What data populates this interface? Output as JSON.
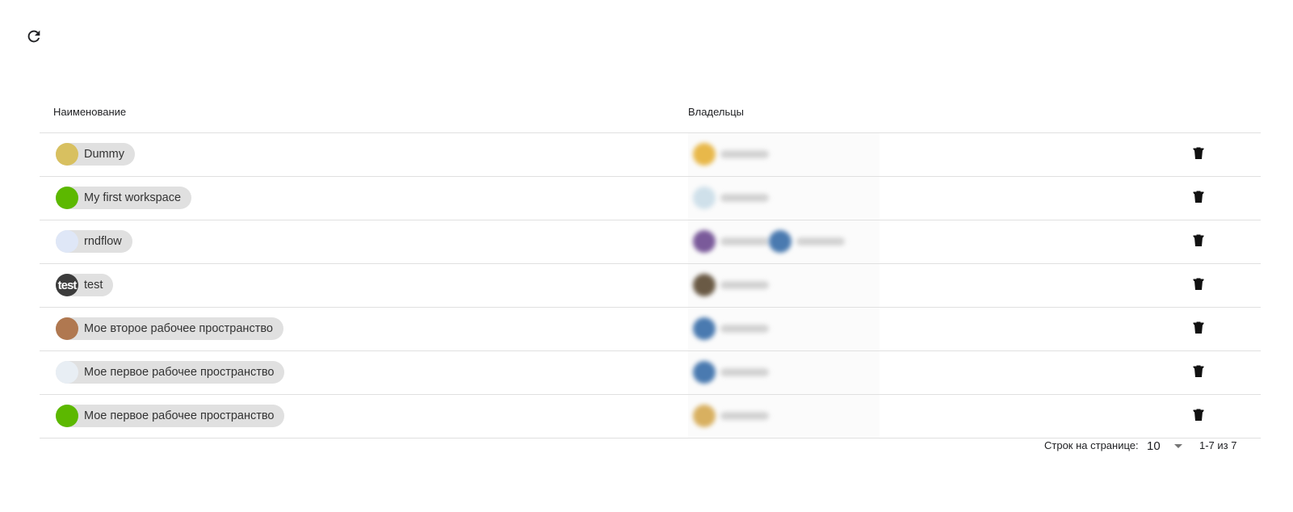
{
  "toolbar": {
    "refresh_icon": "refresh-icon"
  },
  "table": {
    "headers": {
      "name": "Наименование",
      "owners": "Владельцы"
    },
    "rows": [
      {
        "name": "Dummy",
        "avatar_color": "#d8c060",
        "owners": [
          {
            "color": "#e8b84a"
          }
        ]
      },
      {
        "name": "My first workspace",
        "avatar_color": "#5cb800",
        "owners": [
          {
            "color": "#cfe0ea"
          }
        ]
      },
      {
        "name": "rndflow",
        "avatar_color": "#dfe7f7",
        "owners": [
          {
            "color": "#7a5a9a"
          },
          {
            "color": "#4a7ab0"
          }
        ]
      },
      {
        "name": "test",
        "avatar_color": "#3c3c3c",
        "avatar_text": "test",
        "owners": [
          {
            "color": "#6a5a45"
          }
        ]
      },
      {
        "name": "Мое второе рабочее пространство",
        "avatar_color": "#b07850",
        "owners": [
          {
            "color": "#4a7ab0"
          }
        ]
      },
      {
        "name": "Мое первое рабочее пространство",
        "avatar_color": "#e8eef4",
        "owners": [
          {
            "color": "#4a7ab0"
          }
        ]
      },
      {
        "name": "Мое первое рабочее пространство",
        "avatar_color": "#5cb800",
        "owners": [
          {
            "color": "#d8b060"
          }
        ]
      }
    ]
  },
  "footer": {
    "rows_per_page_label": "Строк на странице:",
    "rows_per_page_value": "10",
    "range_text": "1-7 из 7"
  }
}
